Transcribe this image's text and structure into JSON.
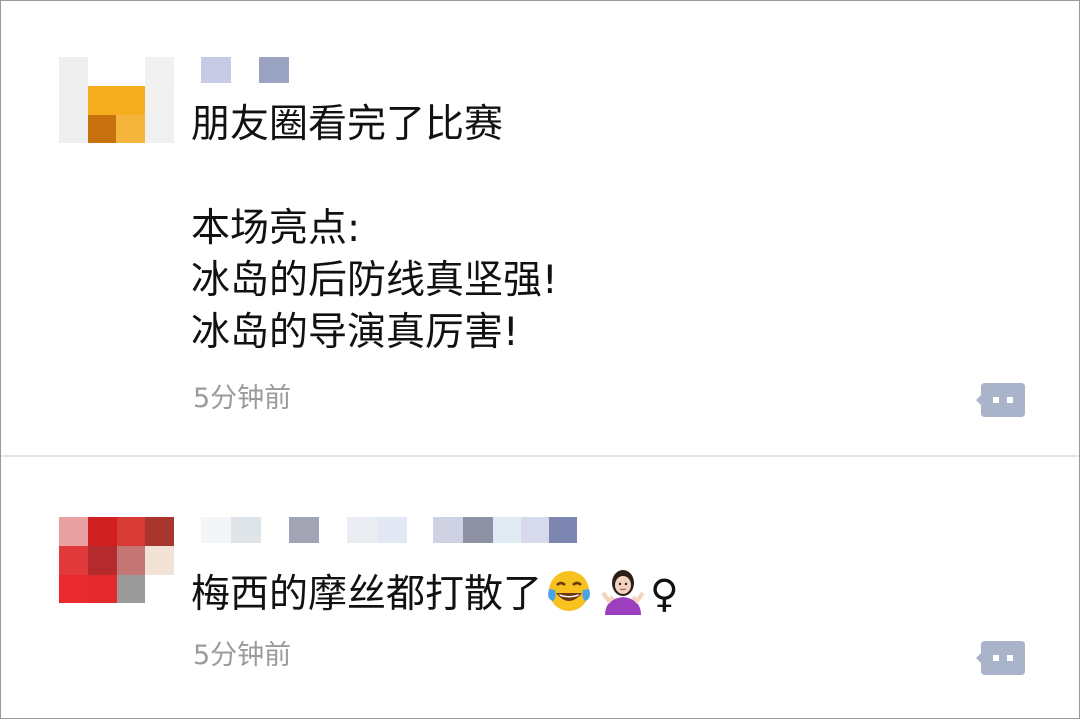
{
  "posts": [
    {
      "avatar": "pixelated-avatar-orange",
      "username": "",
      "content": "朋友圈看完了比赛\n\n本场亮点:\n冰岛的后防线真坚强!\n冰岛的导演真厉害!",
      "timestamp": "5分钟前",
      "action_icon": "comment-icon"
    },
    {
      "avatar": "pixelated-avatar-red",
      "username": "",
      "content": "梅西的摩丝都打散了",
      "emojis": [
        "tears-of-joy-emoji",
        "woman-shrugging-emoji"
      ],
      "timestamp": "5分钟前",
      "action_icon": "comment-icon"
    }
  ],
  "colors": {
    "timestamp": "#9b9b9b",
    "comment_icon": "#a9b3c9",
    "divider": "#e4e4e4"
  }
}
